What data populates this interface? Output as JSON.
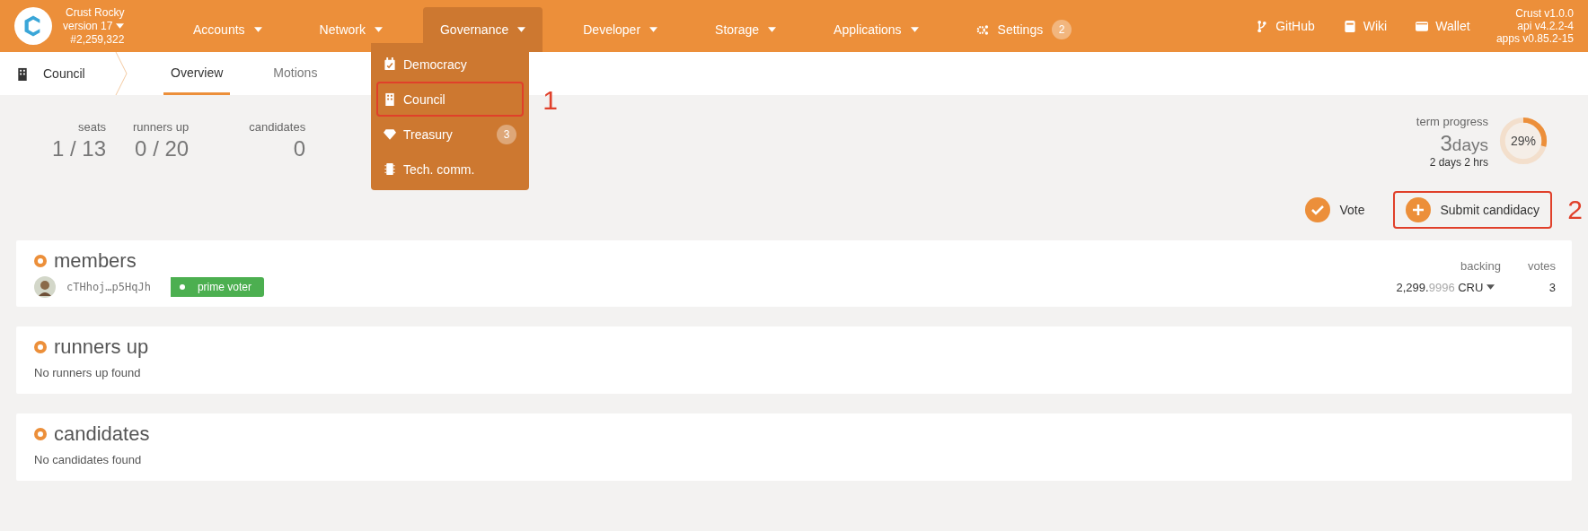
{
  "chain": {
    "name": "Crust Rocky",
    "version": "version 17",
    "block": "#2,259,322"
  },
  "nav": [
    {
      "label": "Accounts",
      "kind": "menu",
      "selected": false
    },
    {
      "label": "Network",
      "kind": "menu",
      "selected": false
    },
    {
      "label": "Governance",
      "kind": "menu",
      "selected": true
    },
    {
      "label": "Developer",
      "kind": "menu",
      "selected": false
    },
    {
      "label": "Storage",
      "kind": "menu",
      "selected": false
    },
    {
      "label": "Applications",
      "kind": "menu",
      "selected": false
    },
    {
      "label": "Settings",
      "kind": "settings",
      "selected": false,
      "badge": "2"
    }
  ],
  "links": [
    {
      "label": "GitHub"
    },
    {
      "label": "Wiki"
    },
    {
      "label": "Wallet"
    }
  ],
  "versions": [
    "Crust v1.0.0",
    "api v4.2.2-4",
    "apps v0.85.2-15"
  ],
  "dropdown": [
    {
      "label": "Democracy",
      "highlighted": false
    },
    {
      "label": "Council",
      "highlighted": true,
      "callout": "1"
    },
    {
      "label": "Treasury",
      "highlighted": false,
      "badge": "3"
    },
    {
      "label": "Tech. comm.",
      "highlighted": false
    }
  ],
  "section": "Council",
  "tabs": [
    {
      "label": "Overview",
      "selected": true
    },
    {
      "label": "Motions",
      "selected": false
    }
  ],
  "stats": [
    {
      "label": "seats",
      "value": "1 / 13"
    },
    {
      "label": "runners up",
      "value": "0 / 20"
    },
    {
      "label": "candidates",
      "value": "0"
    }
  ],
  "term": {
    "label": "term progress",
    "value": "3",
    "unit": "days",
    "remaining": "2 days 2 hrs",
    "percent": "29%",
    "level": 0.29
  },
  "actions": [
    {
      "label": "Vote",
      "highlighted": false
    },
    {
      "label": "Submit candidacy",
      "highlighted": true,
      "callout": "2"
    }
  ],
  "members": {
    "title": "members",
    "columns": [
      "backing",
      "votes"
    ],
    "rows": [
      {
        "address": "cTHhoj…p5HqJh",
        "tag": "prime voter",
        "backing_whole": "2,299.",
        "backing_fraction": "9996",
        "unit": "CRU",
        "votes": "3"
      }
    ]
  },
  "runners_up": {
    "title": "runners up",
    "empty": "No runners up found"
  },
  "candidates": {
    "title": "candidates",
    "empty": "No candidates found"
  }
}
